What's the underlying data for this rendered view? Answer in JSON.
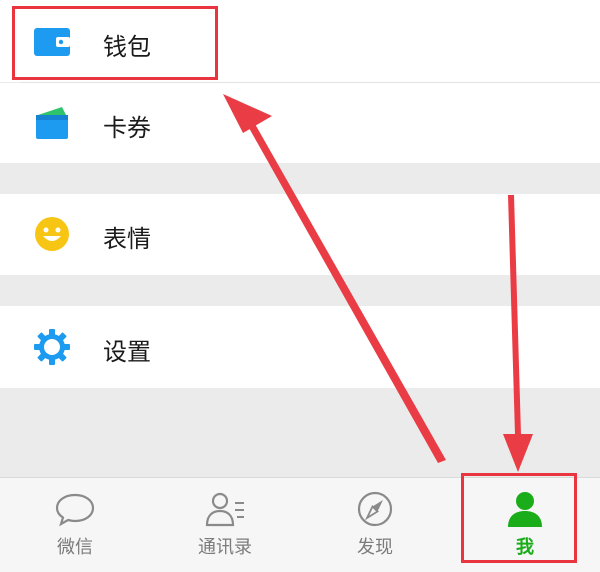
{
  "menu": {
    "items": [
      {
        "label": "钱包",
        "icon": "wallet-icon"
      },
      {
        "label": "卡券",
        "icon": "card-coupon-icon"
      },
      {
        "label": "表情",
        "icon": "smiley-icon"
      },
      {
        "label": "设置",
        "icon": "gear-icon"
      }
    ]
  },
  "tabbar": {
    "tabs": [
      {
        "label": "微信",
        "icon": "chat-bubble-icon"
      },
      {
        "label": "通讯录",
        "icon": "contacts-icon"
      },
      {
        "label": "发现",
        "icon": "compass-icon"
      },
      {
        "label": "我",
        "icon": "person-icon",
        "active": true
      }
    ]
  },
  "colors": {
    "accent_green": "#1aad19",
    "annotation_red": "#e8353f",
    "icon_blue": "#1d9bf0",
    "icon_yellow": "#f7c614"
  }
}
